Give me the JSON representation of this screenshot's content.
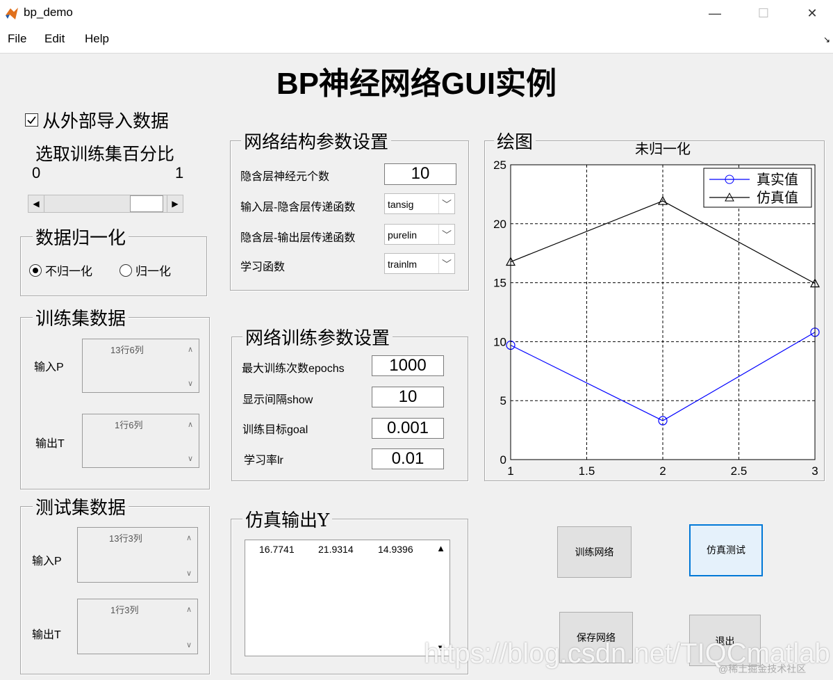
{
  "window": {
    "title": "bp_demo",
    "minimize": "—",
    "maximize": "☐",
    "close": "✕"
  },
  "menu": {
    "file": "File",
    "edit": "Edit",
    "help": "Help",
    "overflow": "↘"
  },
  "main_title": "BP神经网络GUI实例",
  "import_checkbox": {
    "label": "从外部导入数据",
    "checked": true
  },
  "slider": {
    "title": "选取训练集百分比",
    "min_label": "0",
    "max_label": "1",
    "value_fraction": 0.95
  },
  "normalize": {
    "title": "数据归一化",
    "option_none": "不归一化",
    "option_norm": "归一化",
    "selected": "不归一化"
  },
  "train_data": {
    "title": "训练集数据",
    "input_label": "输入P",
    "input_value": "13行6列",
    "output_label": "输出T",
    "output_value": "1行6列"
  },
  "test_data": {
    "title": "测试集数据",
    "input_label": "输入P",
    "input_value": "13行3列",
    "output_label": "输出T",
    "output_value": "1行3列"
  },
  "structure": {
    "title": "网络结构参数设置",
    "hidden_neurons_label": "隐含层神经元个数",
    "hidden_neurons_value": "10",
    "in_hidden_tf_label": "输入层-隐含层传递函数",
    "in_hidden_tf_value": "tansig",
    "hidden_out_tf_label": "隐含层-输出层传递函数",
    "hidden_out_tf_value": "purelin",
    "learn_fn_label": "学习函数",
    "learn_fn_value": "trainlm"
  },
  "training": {
    "title": "网络训练参数设置",
    "epochs_label": "最大训练次数epochs",
    "epochs_value": "1000",
    "show_label": "显示间隔show",
    "show_value": "10",
    "goal_label": "训练目标goal",
    "goal_value": "0.001",
    "lr_label": "学习率lr",
    "lr_value": "0.01"
  },
  "sim_output": {
    "title": "仿真输出Y",
    "values": [
      "16.7741",
      "21.9314",
      "14.9396"
    ]
  },
  "plot_panel": {
    "title": "绘图"
  },
  "buttons": {
    "train": "训练网络",
    "sim_test": "仿真测试",
    "save": "保存网络",
    "exit": "退出"
  },
  "watermark": {
    "url": "https://blog.csdn.net/TIQCmatlab",
    "community": "@稀土掘金技术社区"
  },
  "chart_data": {
    "type": "line",
    "title": "未归一化",
    "x": [
      1,
      2,
      3
    ],
    "series": [
      {
        "name": "真实值",
        "values": [
          9.7,
          3.3,
          10.8
        ],
        "color": "#0000ff",
        "marker": "circle"
      },
      {
        "name": "仿真值",
        "values": [
          16.7741,
          21.9314,
          14.9396
        ],
        "color": "#000000",
        "marker": "triangle"
      }
    ],
    "xlim": [
      1,
      3
    ],
    "ylim": [
      0,
      25
    ],
    "xticks": [
      "1",
      "1.5",
      "2",
      "2.5",
      "3"
    ],
    "yticks": [
      "0",
      "5",
      "10",
      "15",
      "20",
      "25"
    ],
    "grid": true,
    "legend_position": "top-right"
  }
}
